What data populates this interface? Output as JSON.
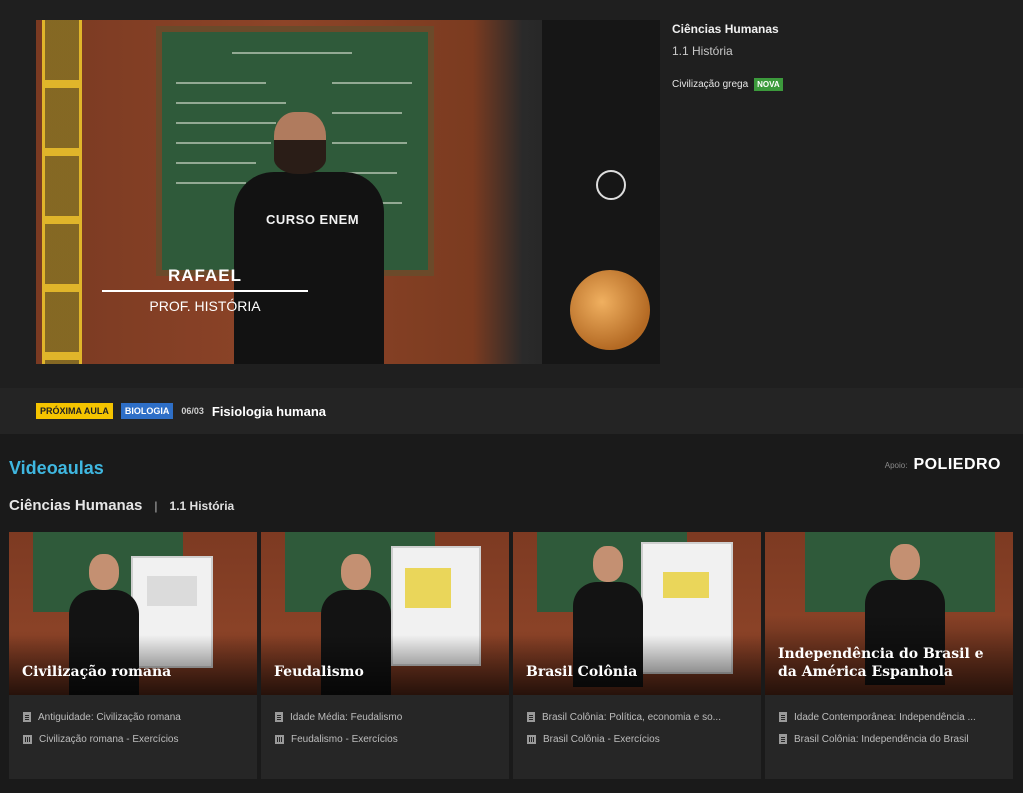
{
  "video": {
    "teacher_name": "RAFAEL",
    "teacher_role": "PROF. HISTÓRIA",
    "shirt_logo": "CURSO ENEM"
  },
  "lesson": {
    "title": "Ciências Humanas",
    "subtitle": "1.1 História",
    "topic": "Civilização grega",
    "badge": "NOVA"
  },
  "next_lesson": {
    "label": "PRÓXIMA AULA",
    "subject": "BIOLOGIA",
    "date": "06/03",
    "title": "Fisiologia humana"
  },
  "section": {
    "title": "Videoaulas",
    "sponsor_label": "Apoio:",
    "sponsor_name": "POLIEDRO",
    "breadcrumb_main": "Ciências Humanas",
    "breadcrumb_sep": "|",
    "breadcrumb_sub": "1.1 História"
  },
  "cards": [
    {
      "title": "Civilização romana",
      "items": [
        {
          "icon": "document-icon",
          "text": "Antiguidade: Civilização romana"
        },
        {
          "icon": "exercise-icon",
          "text": "Civilização romana - Exercícios"
        }
      ]
    },
    {
      "title": "Feudalismo",
      "items": [
        {
          "icon": "document-icon",
          "text": "Idade Média: Feudalismo"
        },
        {
          "icon": "exercise-icon",
          "text": "Feudalismo - Exercícios"
        }
      ]
    },
    {
      "title": "Brasil Colônia",
      "items": [
        {
          "icon": "document-icon",
          "text": "Brasil Colônia: Política, economia e so..."
        },
        {
          "icon": "exercise-icon",
          "text": "Brasil Colônia - Exercícios"
        }
      ]
    },
    {
      "title": "Independência do Brasil e da América Espanhola",
      "items": [
        {
          "icon": "document-icon",
          "text": "Idade Contemporânea: Independência ..."
        },
        {
          "icon": "document-icon",
          "text": "Brasil Colônia: Independência do Brasil"
        }
      ]
    }
  ]
}
